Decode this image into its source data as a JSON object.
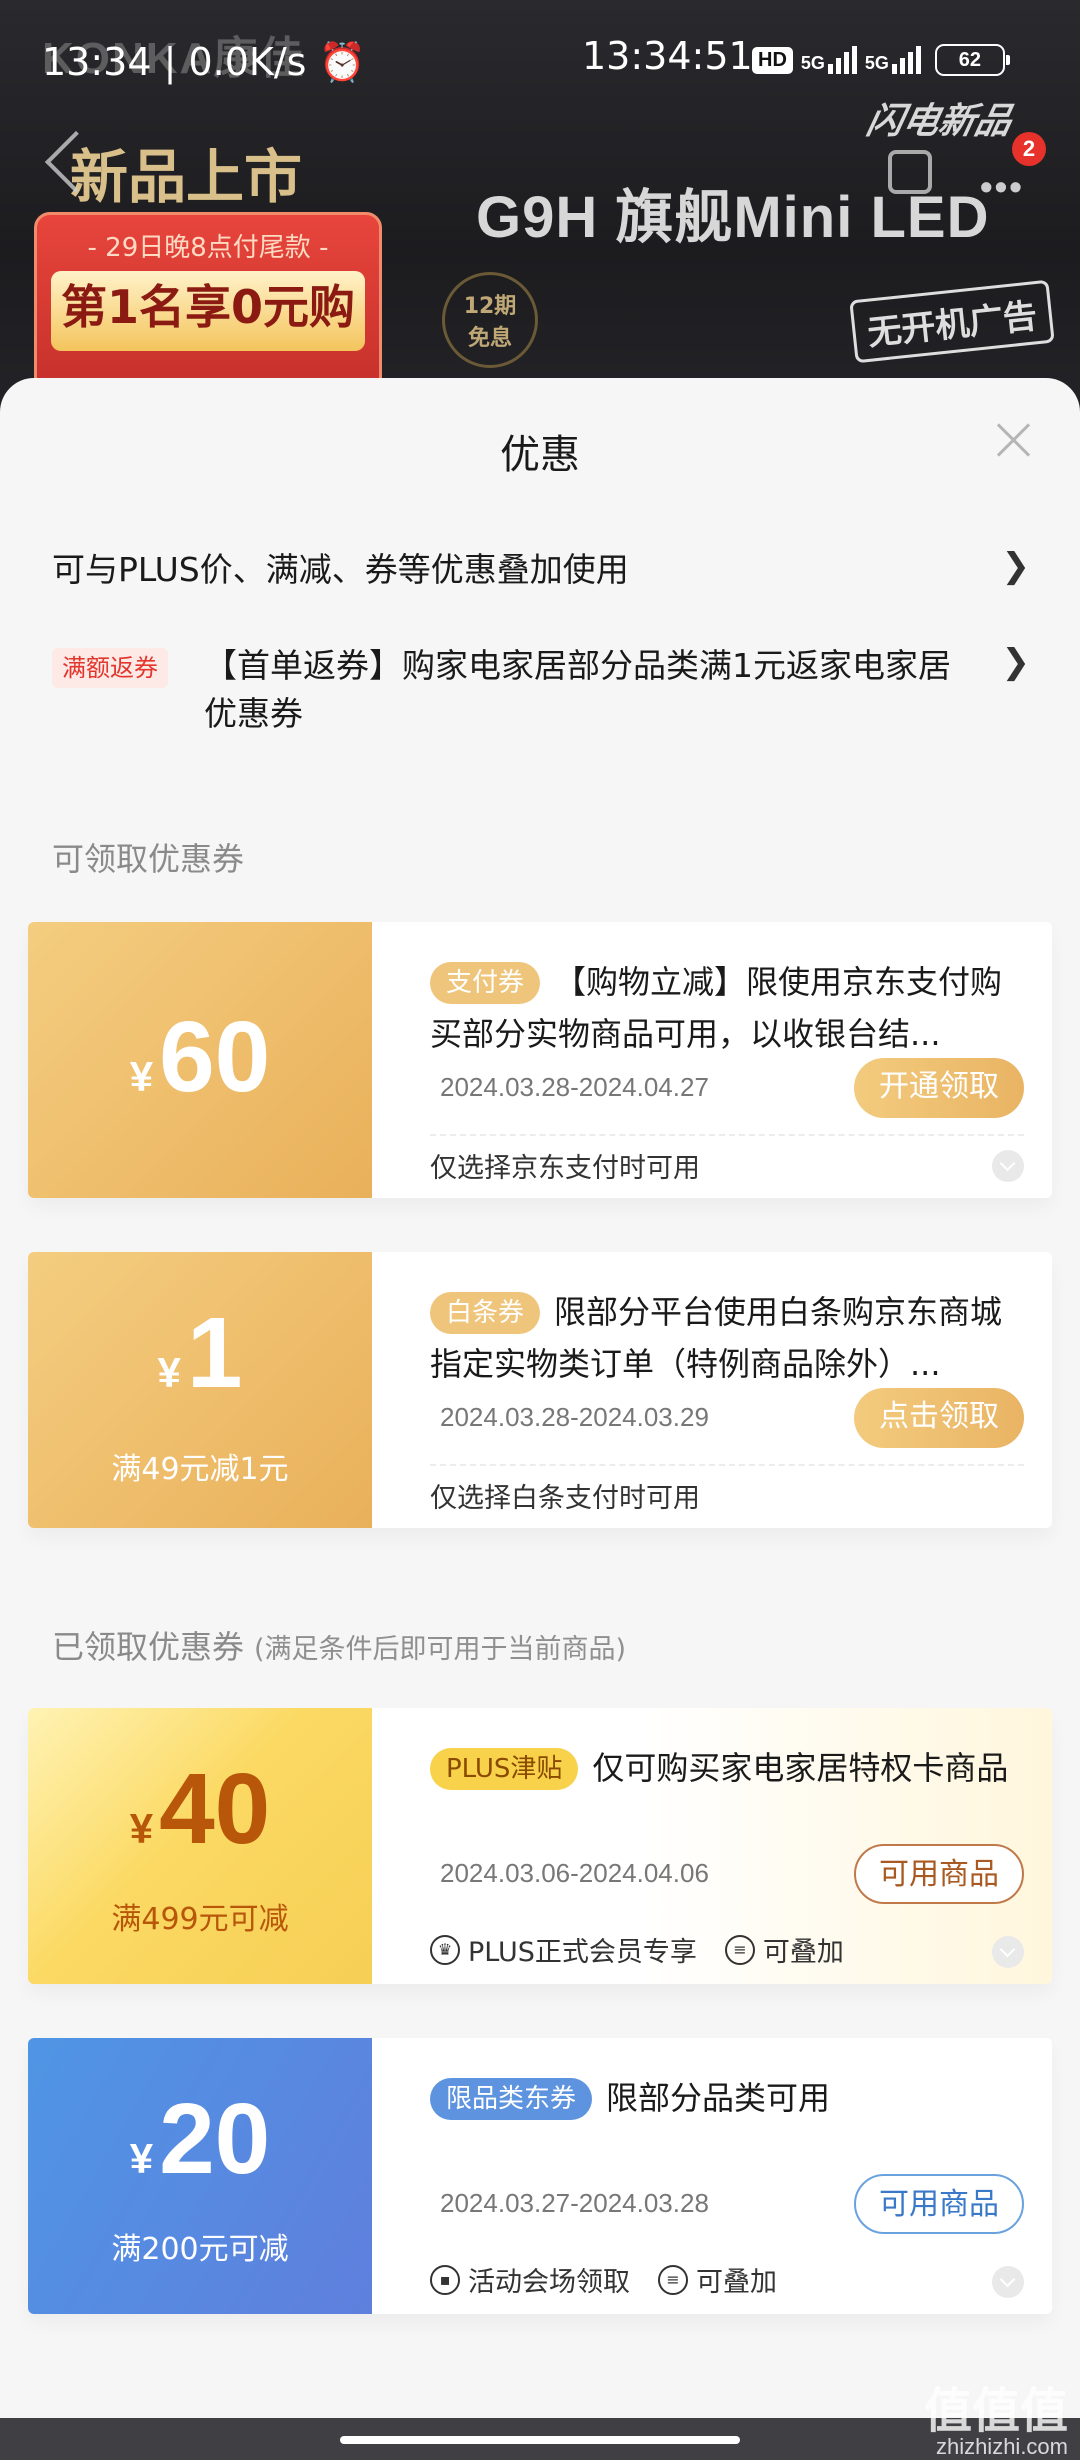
{
  "status_bar": {
    "left_time": "13:34",
    "net_speed": "0.0K/s",
    "center_time": "13:34:51",
    "hd": "HD",
    "sim1": "5G",
    "sim2": "5G",
    "battery": "62"
  },
  "banner": {
    "brand": "KONKA康佳",
    "headline": "新品上市",
    "promo_sub": "- 29日晚8点付尾款 -",
    "promo_main": "第1名享0元购",
    "installment": [
      "12期",
      "免息"
    ],
    "product_title": "G9H 旗舰Mini LED",
    "flash_logo": "闪电新品",
    "noad": "无开机广告",
    "more_badge": "2"
  },
  "sheet": {
    "title": "优惠",
    "promo_rows": [
      {
        "text": "可与PLUS价、满减、券等优惠叠加使用",
        "chevron": "❯"
      },
      {
        "tag": "满额返券",
        "text": "【首单返券】购家电家居部分品类满1元返家电家居优惠券",
        "chevron": "❯"
      }
    ],
    "available_title": "可领取优惠券",
    "claimed_title": "已领取优惠券",
    "claimed_hint": "(满足条件后即可用于当前商品)"
  },
  "coupons": [
    {
      "currency": "¥",
      "amount": "60",
      "condition": "",
      "tag": "支付券",
      "desc": "【购物立减】限使用京东支付购买部分实物商品可用，以收银台结...",
      "date": "2024.03.28-2024.04.27",
      "button": "开通领取",
      "note": "仅选择京东支付时可用"
    },
    {
      "currency": "¥",
      "amount": "1",
      "condition": "满49元减1元",
      "tag": "白条券",
      "desc": "限部分平台使用白条购京东商城指定实物类订单（特例商品除外）...",
      "date": "2024.03.28-2024.03.29",
      "button": "点击领取",
      "note": "仅选择白条支付时可用"
    },
    {
      "currency": "¥",
      "amount": "40",
      "condition": "满499元可减",
      "tag": "PLUS津贴",
      "desc": "仅可购买家电家居特权卡商品",
      "date": "2024.03.06-2024.04.06",
      "button": "可用商品",
      "note1": "PLUS正式会员专享",
      "note2": "可叠加"
    },
    {
      "currency": "¥",
      "amount": "20",
      "condition": "满200元可减",
      "tag": "限品类东券",
      "desc": "限部分品类可用",
      "date": "2024.03.27-2024.03.28",
      "button": "可用商品",
      "note1": "活动会场领取",
      "note2": "可叠加"
    }
  ],
  "watermark": {
    "main": "值值值",
    "site": "zhizhizhi.com"
  },
  "colors": {
    "red": "#e2362d",
    "gold": "#e9b05a",
    "plus_yellow": "#f8d24a",
    "blue": "#5e94df"
  }
}
